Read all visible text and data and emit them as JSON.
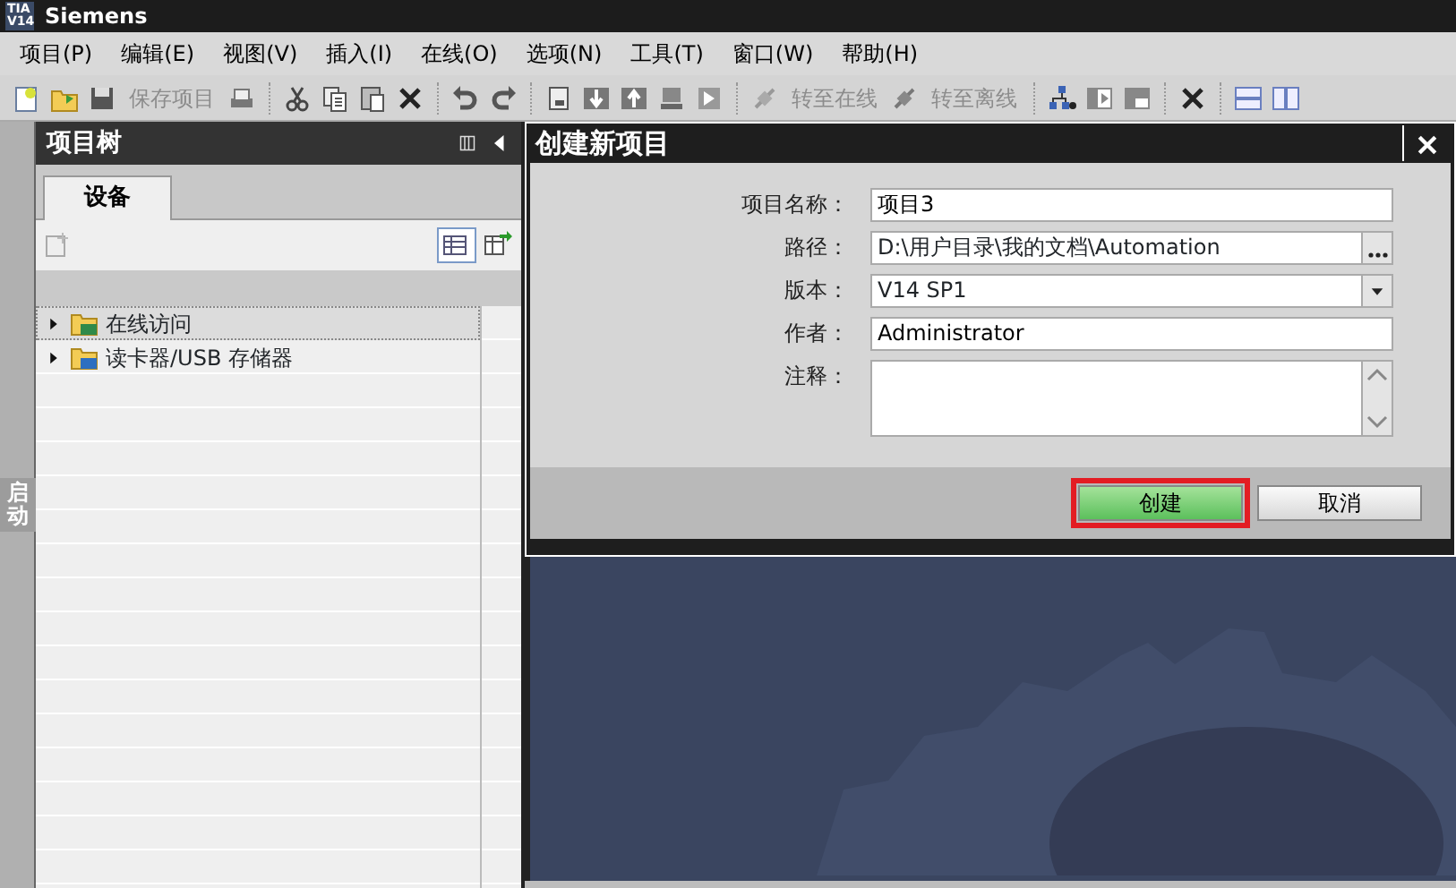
{
  "window": {
    "logo_top": "TIA",
    "logo_bottom": "V14",
    "title": "Siemens"
  },
  "menu": [
    "项目(P)",
    "编辑(E)",
    "视图(V)",
    "插入(I)",
    "在线(O)",
    "选项(N)",
    "工具(T)",
    "窗口(W)",
    "帮助(H)"
  ],
  "toolbar": [
    {
      "kind": "icon"
    },
    {
      "kind": "icon"
    },
    {
      "kind": "icon"
    },
    {
      "kind": "text",
      "label": "保存项目",
      "disabled": true
    },
    {
      "kind": "icon"
    },
    {
      "kind": "separator"
    },
    {
      "kind": "icon"
    },
    {
      "kind": "icon"
    },
    {
      "kind": "icon"
    },
    {
      "kind": "icon"
    },
    {
      "kind": "separator"
    },
    {
      "kind": "icon"
    },
    {
      "kind": "icon"
    },
    {
      "kind": "separator"
    },
    {
      "kind": "icon"
    },
    {
      "kind": "icon"
    },
    {
      "kind": "icon"
    },
    {
      "kind": "icon"
    },
    {
      "kind": "icon"
    },
    {
      "kind": "separator"
    },
    {
      "kind": "icon"
    },
    {
      "kind": "text",
      "label": "转至在线",
      "disabled": true
    },
    {
      "kind": "icon"
    },
    {
      "kind": "text",
      "label": "转至离线",
      "disabled": true
    },
    {
      "kind": "separator"
    },
    {
      "kind": "icon"
    },
    {
      "kind": "icon"
    },
    {
      "kind": "icon"
    },
    {
      "kind": "separator"
    },
    {
      "kind": "icon"
    },
    {
      "kind": "separator"
    },
    {
      "kind": "icon"
    },
    {
      "kind": "icon"
    }
  ],
  "side_strip": {
    "label": "启动"
  },
  "project_tree": {
    "title": "项目树",
    "tabs": [
      {
        "label": "设备",
        "selected": true
      }
    ],
    "items": [
      {
        "label": "在线访问",
        "expanded": false,
        "selected": true
      },
      {
        "label": "读卡器/USB 存储器",
        "expanded": false,
        "selected": false
      }
    ]
  },
  "dialog": {
    "title": "创建新项目",
    "fields": [
      {
        "label": "项目名称：",
        "kind": "text",
        "value": "项目3"
      },
      {
        "label": "路径：",
        "kind": "browse",
        "value": "D:\\用户目录\\我的文档\\Automation"
      },
      {
        "label": "版本：",
        "kind": "select",
        "value": "V14 SP1"
      },
      {
        "label": "作者：",
        "kind": "text",
        "value": "Administrator"
      },
      {
        "label": "注释：",
        "kind": "textarea"
      }
    ],
    "buttons": [
      {
        "label": "创建",
        "highlighted": true
      },
      {
        "label": "取消",
        "highlighted": false
      }
    ]
  }
}
